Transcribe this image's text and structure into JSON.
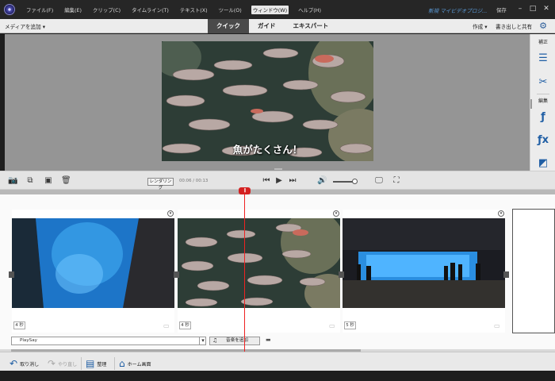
{
  "menubar": {
    "items": [
      "ファイル(F)",
      "編集(E)",
      "クリップ(C)",
      "タイムライン(T)",
      "テキスト(X)",
      "ツール(O)",
      "ウィンドウ(W)",
      "ヘルプ(H)"
    ],
    "active_index": 6,
    "project_title": "新規 マイビデオプロジ...",
    "save_label": "保存",
    "minimize_symbol": "–",
    "maximize_symbol": "□",
    "close_symbol": "✕"
  },
  "modebar": {
    "add_media": "メディアを追加 ▾",
    "tabs": [
      "クイック",
      "ガイド",
      "エキスパート"
    ],
    "active_tab": 0,
    "create_dropdown": "作成 ▾",
    "export_share": "書き出しと共有"
  },
  "monitor": {
    "subtitle": "魚がたくさん！"
  },
  "right_panel": {
    "adjust_label": "補正",
    "edit_label": "編集"
  },
  "controls": {
    "render_label": "レンダリング",
    "timecode": "00:06 / 00:13"
  },
  "timeline": {
    "clips": [
      {
        "duration": "4 秒"
      },
      {
        "duration": "4 秒"
      },
      {
        "duration": "5 秒"
      }
    ],
    "audio_track_name": "PlaySay",
    "add_music_label": "音楽を追加"
  },
  "bottombar": {
    "undo_label": "取り消し",
    "redo_label": "やり直し",
    "organize_label": "整理",
    "home_label": "ホーム画面"
  },
  "colors": {
    "accent_blue": "#1f5ea4",
    "playhead_red": "#d42121",
    "active_tab_bg": "#4a4a4a"
  },
  "icons": {
    "undo": "undo-icon",
    "redo": "redo-icon",
    "organize": "organizer-icon",
    "home": "home-icon"
  }
}
